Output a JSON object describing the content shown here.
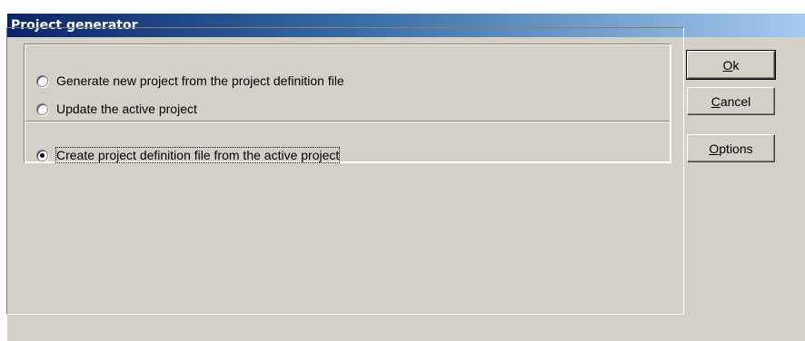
{
  "window": {
    "title": "Project generator"
  },
  "options": [
    {
      "label": "Generate new project from the project definition file",
      "selected": false
    },
    {
      "label": "Update the active project",
      "selected": false
    },
    {
      "label": "Create project definition file from the active project",
      "selected": true
    }
  ],
  "buttons": {
    "ok": {
      "mnemonic": "O",
      "rest": "k"
    },
    "cancel": {
      "mnemonic": "C",
      "rest": "ancel"
    },
    "options": {
      "mnemonic": "O",
      "rest": "ptions"
    }
  }
}
